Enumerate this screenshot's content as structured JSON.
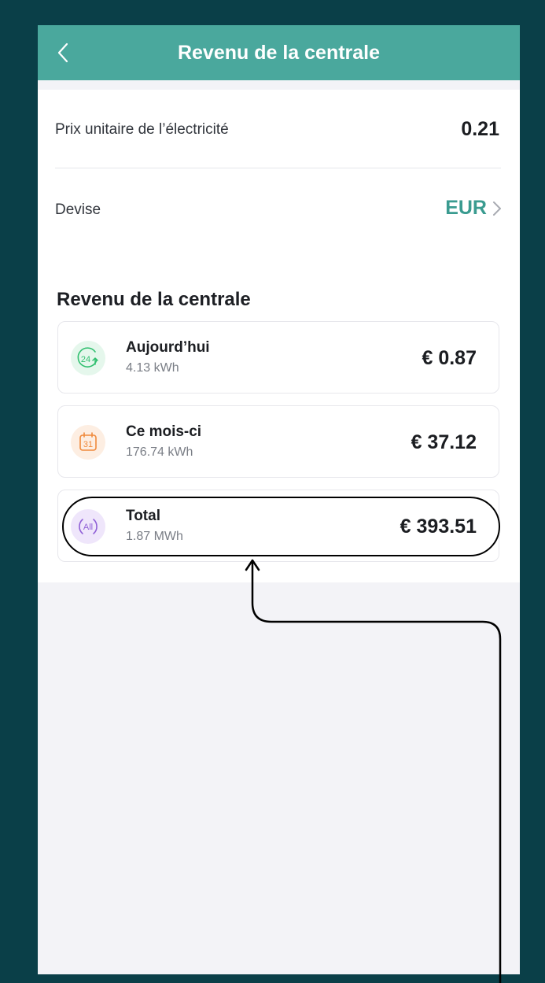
{
  "header": {
    "title": "Revenu de la centrale"
  },
  "settings": {
    "unit_price_label": "Prix unitaire de l’électricité",
    "unit_price_value": "0.21",
    "currency_label": "Devise",
    "currency_value": "EUR"
  },
  "revenue": {
    "section_title": "Revenu de la centrale",
    "items": [
      {
        "name": "Aujourd’hui",
        "energy": "4.13 kWh",
        "amount": "€ 0.87",
        "icon": "24h-icon",
        "icon_text": "24"
      },
      {
        "name": "Ce mois-ci",
        "energy": "176.74 kWh",
        "amount": "€ 37.12",
        "icon": "calendar-icon",
        "icon_text": "31"
      },
      {
        "name": "Total",
        "energy": "1.87 MWh",
        "amount": "€ 393.51",
        "icon": "all-icon",
        "icon_text": "All"
      }
    ]
  },
  "colors": {
    "header": "#4aa89d",
    "accent": "#3a9b90",
    "frame": "#0a3f48",
    "today_icon": "#2fbf6e",
    "month_icon": "#f08a3c",
    "total_icon": "#8f5fd6"
  }
}
